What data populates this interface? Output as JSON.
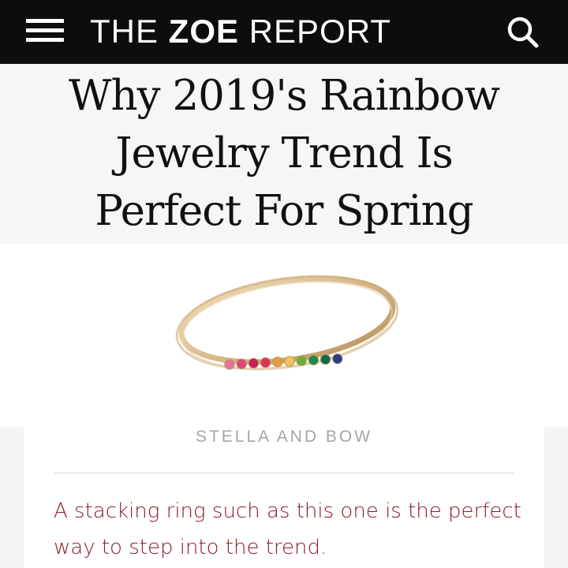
{
  "header": {
    "logo_prefix": "THE",
    "logo_bold": "ZOE",
    "logo_suffix": "REPORT",
    "menu_icon": "hamburger-menu-icon",
    "search_icon": "search-icon",
    "background_color": "#0d0d0d"
  },
  "article": {
    "headline_lines": [
      "Why 2019's Rainbow",
      "Jewelry Trend Is",
      "Perfect For Spring"
    ],
    "image": {
      "subject": "gold stacking ring with rainbow stones"
    },
    "credit": "STELLA AND BOW",
    "caption": "A stacking ring such as this one is the perfect way to step into the trend."
  },
  "colors": {
    "caption_text": "#8a1c2a",
    "credit_text": "#a6a6a6",
    "ring_gold": "#d8b98a",
    "stones": [
      "#e8709a",
      "#e0457c",
      "#c81e5a",
      "#d9365a",
      "#e89a3e",
      "#f2c257",
      "#6fae3e",
      "#1f8a4c",
      "#0f6b4a",
      "#2a3e8c"
    ]
  }
}
